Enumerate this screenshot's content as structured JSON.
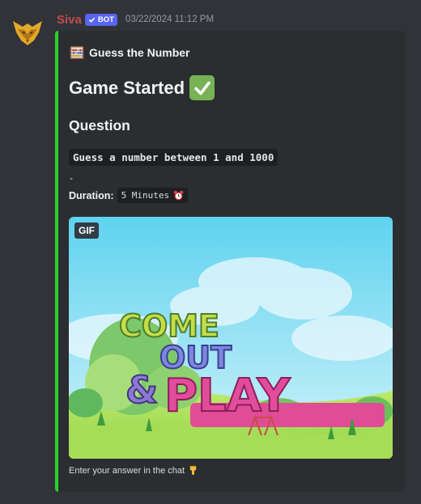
{
  "message": {
    "username": "Siva",
    "badge": "BOT",
    "timestamp": "03/22/2024 11:12 PM"
  },
  "embed": {
    "accent_color": "#2ad12a",
    "author": {
      "icon": "abacus-icon",
      "name": "Guess the Number"
    },
    "title": "Game Started",
    "title_icon": "check-mark-icon",
    "field_name": "Question",
    "question_text": "Guess a number between 1 and 1000",
    "separator": "-",
    "duration_label": "Duration:",
    "duration_value": "5 Minutes",
    "duration_icon": "alarm-clock-icon",
    "media": {
      "badge": "GIF",
      "word1": "COME",
      "word2": "OUT",
      "word3": "&",
      "word4": "PLAY"
    },
    "footer_text": "Enter your answer in the chat",
    "footer_icon": "pointing-down-icon"
  }
}
